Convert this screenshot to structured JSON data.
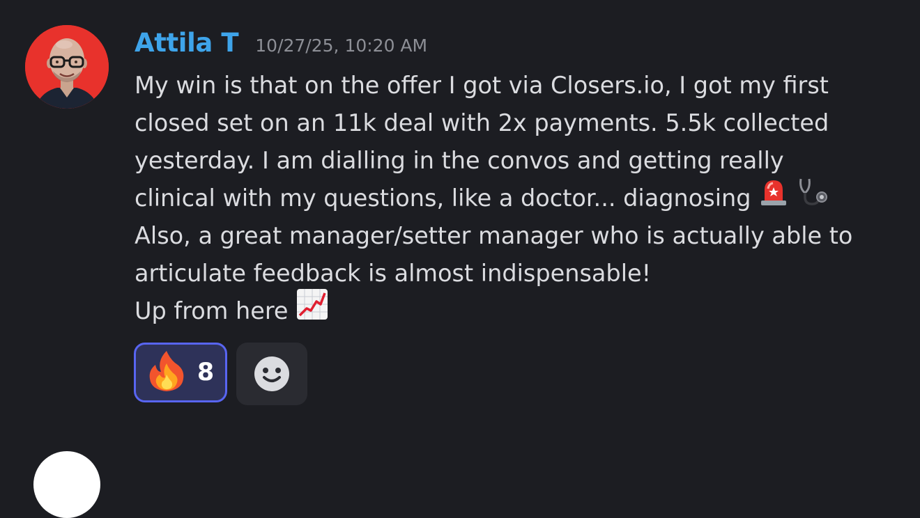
{
  "message": {
    "author": "Attila T",
    "timestamp": "10/27/25, 10:20 AM",
    "lines": [
      "My win is that on the offer I got via Closers.io, I got my first",
      "closed set on an 11k deal with 2x payments. 5.5k collected",
      "yesterday. I am dialling in the convos and getting really",
      "clinical with my questions, like a doctor... diagnosing",
      "Also, a great manager/setter manager who is actually able to",
      "articulate feedback is almost indispensable!",
      "Up from here"
    ],
    "inline_emojis": [
      "rotating-light-emoji",
      "stethoscope-emoji",
      "chart-increasing-emoji"
    ]
  },
  "reactions": [
    {
      "emoji": "fire-emoji",
      "count": "8",
      "selected": true
    }
  ],
  "colors": {
    "background": "#1c1d22",
    "author": "#3ea4ea",
    "timestamp": "#8d8f96",
    "text": "#dbdce0",
    "reaction_border": "#5865f2",
    "reaction_bg": "#2e3259",
    "avatar_bg": "#e8322c"
  }
}
